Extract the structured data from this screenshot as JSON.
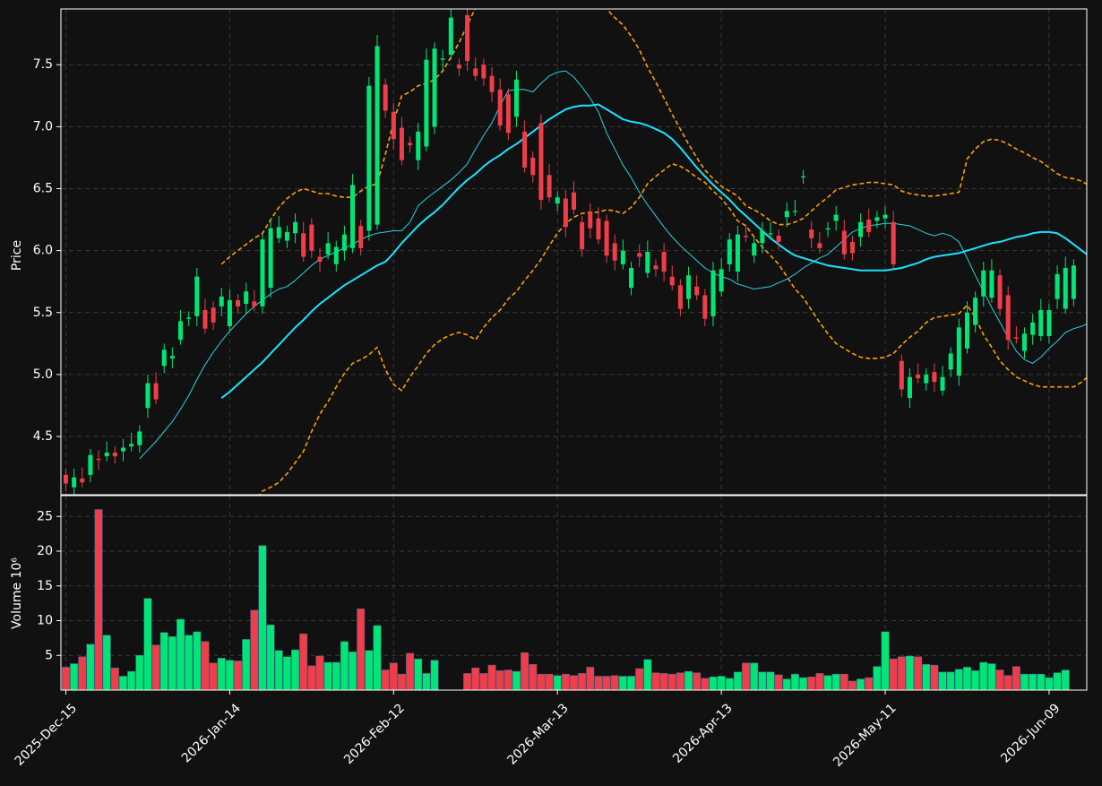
{
  "colors": {
    "background": "#111111",
    "up": "#00e676",
    "down": "#ef3e4a",
    "grid": "#3a3a3a",
    "axis": "#ffffff",
    "ma_short": "#26d4e4",
    "ma_long": "#19e3ff",
    "bands": "#ff9f00"
  },
  "chart_data": [
    {
      "type": "candlestick",
      "ylabel": "Price",
      "ylim": [
        4.03,
        7.95
      ],
      "yticks": [
        "4.5",
        "5.0",
        "5.5",
        "6.0",
        "6.5",
        "7.0",
        "7.5"
      ],
      "xlim": [
        -0.6,
        124.6
      ],
      "x_tick_labels": [
        "2025-Dec-15",
        "2026-Jan-14",
        "2026-Feb-12",
        "2026-Mar-13",
        "2026-Apr-13",
        "2026-May-11",
        "2026-Jun-09"
      ],
      "x_tick_positions": [
        0,
        20,
        40,
        60,
        80,
        100,
        120
      ],
      "grid": true,
      "open": [
        4.19,
        4.09,
        4.16,
        4.19,
        4.32,
        4.34,
        4.37,
        4.38,
        4.42,
        4.43,
        4.73,
        4.93,
        5.07,
        5.13,
        5.28,
        5.45,
        5.47,
        5.52,
        5.54,
        5.55,
        5.39,
        5.6,
        5.57,
        5.59,
        5.55,
        5.7,
        6.1,
        6.08,
        6.14,
        6.14,
        6.21,
        5.95,
        5.97,
        5.89,
        6.0,
        6.02,
        6.2,
        6.16,
        6.21,
        7.34,
        7.12,
        6.99,
        6.87,
        6.73,
        6.84,
        7.0,
        7.54,
        7.58,
        7.5,
        7.9,
        7.47,
        7.5,
        7.41,
        7.3,
        7.26,
        7.08,
        6.96,
        6.75,
        7.03,
        6.61,
        6.38,
        6.42,
        6.47,
        6.23,
        6.31,
        6.26,
        6.24,
        6.06,
        5.89,
        5.7,
        5.98,
        5.82,
        5.88,
        5.99,
        5.79,
        5.72,
        5.61,
        5.71,
        5.64,
        5.47,
        5.67,
        5.89,
        5.83,
        6.12,
        5.96,
        6.06,
        6.14,
        6.12,
        6.27,
        6.32,
        6.6,
        6.17,
        6.06,
        6.17,
        6.24,
        6.16,
        6.07,
        6.11,
        6.25,
        6.24,
        6.26,
        6.23,
        5.11,
        4.81,
        5.0,
        4.93,
        5.02,
        4.87,
        5.04,
        4.99,
        5.21,
        5.4,
        5.63,
        5.62,
        5.8,
        5.64,
        5.3,
        5.19,
        5.32,
        5.31,
        5.31,
        5.61,
        5.53,
        5.61
      ],
      "close": [
        4.12,
        4.17,
        4.13,
        4.35,
        4.31,
        4.37,
        4.34,
        4.41,
        4.44,
        4.54,
        4.93,
        4.8,
        5.2,
        5.15,
        5.43,
        5.46,
        5.79,
        5.37,
        5.42,
        5.63,
        5.6,
        5.55,
        5.67,
        5.55,
        6.09,
        6.18,
        6.19,
        6.15,
        6.23,
        5.95,
        6.0,
        5.91,
        6.06,
        6.03,
        6.13,
        6.53,
        6.02,
        7.33,
        7.65,
        7.13,
        6.9,
        6.73,
        6.85,
        6.96,
        7.54,
        7.63,
        7.55,
        7.88,
        7.47,
        7.53,
        7.41,
        7.39,
        7.28,
        7.01,
        6.95,
        7.38,
        6.67,
        6.61,
        6.41,
        6.43,
        6.43,
        6.19,
        6.33,
        6.01,
        6.18,
        6.09,
        5.96,
        5.92,
        6.0,
        5.86,
        5.95,
        5.99,
        5.85,
        5.83,
        5.72,
        5.53,
        5.8,
        5.64,
        5.45,
        5.84,
        5.85,
        6.09,
        6.13,
        6.11,
        6.06,
        6.16,
        6.14,
        6.07,
        6.32,
        6.32,
        6.6,
        6.1,
        6.02,
        6.18,
        6.29,
        5.97,
        5.98,
        6.23,
        6.15,
        6.27,
        6.29,
        5.89,
        4.88,
        4.98,
        4.97,
        5.0,
        4.94,
        4.98,
        5.17,
        5.38,
        5.5,
        5.62,
        5.84,
        5.84,
        5.53,
        5.28,
        5.29,
        5.33,
        5.42,
        5.52,
        5.52,
        5.81,
        5.86,
        5.88
      ],
      "volume_ylabel": "Volume  10⁶",
      "volume_ylim": [
        0,
        28
      ],
      "volume_yticks": [
        "5",
        "10",
        "15",
        "20",
        "25"
      ],
      "volume": [
        3.3,
        3.8,
        4.8,
        6.6,
        26.0,
        7.9,
        3.2,
        2.0,
        2.7,
        5.0,
        13.2,
        6.5,
        8.3,
        7.7,
        10.2,
        7.9,
        8.4,
        7.0,
        3.9,
        4.6,
        4.3,
        4.2,
        7.3,
        11.5,
        20.8,
        9.4,
        5.7,
        4.8,
        5.8,
        8.1,
        3.5,
        4.9,
        4.0,
        4.0,
        7.0,
        5.5,
        11.7,
        5.7,
        9.3,
        2.9,
        3.9,
        2.3,
        5.3,
        4.5,
        2.4,
        4.3,
        0,
        0,
        0,
        2.4,
        3.2,
        2.4,
        3.6,
        2.8,
        2.9,
        2.7,
        5.4,
        3.7,
        2.3,
        2.3,
        2.1,
        2.3,
        2.1,
        2.4,
        3.3,
        2.0,
        2.0,
        2.1,
        2.0,
        2.0,
        3.1,
        4.4,
        2.5,
        2.4,
        2.3,
        2.5,
        2.7,
        2.5,
        1.7,
        1.9,
        2.0,
        1.7,
        2.6,
        3.9,
        3.9,
        2.6,
        2.6,
        2.2,
        1.6,
        2.3,
        1.8,
        1.9,
        2.4,
        2.1,
        2.3,
        2.3,
        1.3,
        1.6,
        1.8,
        3.4,
        8.4,
        4.5,
        4.8,
        4.9,
        4.8,
        3.7,
        3.6,
        2.6,
        2.6,
        3.0,
        3.3,
        2.8,
        4.0,
        3.8,
        2.9,
        2.1,
        3.4,
        2.3,
        2.3,
        2.3,
        1.8,
        2.5,
        2.9
      ],
      "overlays": {
        "ma_short": {
          "start": 9,
          "values": [
            4.32,
            4.39,
            4.46,
            4.54,
            4.62,
            4.72,
            4.83,
            4.96,
            5.08,
            5.18,
            5.27,
            5.35,
            5.42,
            5.49,
            5.55,
            5.6,
            5.65,
            5.69,
            5.71,
            5.76,
            5.82,
            5.88,
            5.93,
            5.96,
            5.99,
            6.02,
            6.05,
            6.09,
            6.12,
            6.14,
            6.15,
            6.16,
            6.16,
            6.23,
            6.36,
            6.42,
            6.47,
            6.52,
            6.57,
            6.63,
            6.7,
            6.82,
            6.93,
            7.03,
            7.17,
            7.29,
            7.3,
            7.3,
            7.28,
            7.35,
            7.41,
            7.44,
            7.45,
            7.4,
            7.32,
            7.23,
            7.12,
            6.95,
            6.82,
            6.69,
            6.59,
            6.47,
            6.37,
            6.28,
            6.19,
            6.11,
            6.04,
            5.98,
            5.92,
            5.86,
            5.82,
            5.79,
            5.77,
            5.73,
            5.71,
            5.69,
            5.7,
            5.71,
            5.74,
            5.77,
            5.81,
            5.86,
            5.9,
            5.94,
            5.97,
            6.03,
            6.09,
            6.15,
            6.18,
            6.2,
            6.21,
            6.22,
            6.22,
            6.21,
            6.2,
            6.17,
            6.14,
            6.12,
            6.14,
            6.12,
            6.07,
            5.94,
            5.8,
            5.67,
            5.54,
            5.42,
            5.3,
            5.19,
            5.12,
            5.09,
            5.14,
            5.21,
            5.27,
            5.34,
            5.37,
            5.39,
            5.42,
            5.46,
            5.48,
            5.49,
            5.5,
            5.5,
            5.49,
            5.5,
            5.51
          ]
        },
        "ma_long": {
          "start": 19,
          "values": [
            4.81,
            4.86,
            4.92,
            4.98,
            5.04,
            5.1,
            5.17,
            5.24,
            5.31,
            5.38,
            5.44,
            5.51,
            5.57,
            5.62,
            5.67,
            5.72,
            5.76,
            5.8,
            5.84,
            5.88,
            5.91,
            5.98,
            6.06,
            6.13,
            6.2,
            6.26,
            6.31,
            6.37,
            6.44,
            6.51,
            6.57,
            6.62,
            6.68,
            6.73,
            6.77,
            6.82,
            6.86,
            6.91,
            6.96,
            7.01,
            7.06,
            7.1,
            7.14,
            7.16,
            7.17,
            7.17,
            7.18,
            7.14,
            7.1,
            7.06,
            7.04,
            7.03,
            7.01,
            6.98,
            6.95,
            6.9,
            6.83,
            6.75,
            6.67,
            6.6,
            6.53,
            6.47,
            6.41,
            6.34,
            6.28,
            6.22,
            6.16,
            6.1,
            6.05,
            6.0,
            5.96,
            5.94,
            5.92,
            5.9,
            5.88,
            5.87,
            5.86,
            5.85,
            5.84,
            5.84,
            5.84,
            5.84,
            5.85,
            5.86,
            5.88,
            5.9,
            5.93,
            5.95,
            5.96,
            5.97,
            5.98,
            6.0,
            6.02,
            6.04,
            6.06,
            6.07,
            6.09,
            6.11,
            6.12,
            6.14,
            6.15,
            6.15,
            6.14,
            6.1,
            6.05,
            6.0,
            5.95,
            5.89,
            5.82,
            5.76,
            5.71,
            5.67,
            5.64,
            5.61,
            5.59,
            5.56,
            5.53,
            5.49,
            5.45,
            5.41,
            5.37,
            5.34,
            5.32,
            5.31,
            5.34,
            5.38,
            5.42
          ]
        },
        "upper_band": {
          "start": 19,
          "values": [
            5.89,
            5.95,
            6.0,
            6.05,
            6.1,
            6.14,
            6.25,
            6.35,
            6.42,
            6.47,
            6.5,
            6.48,
            6.46,
            6.46,
            6.44,
            6.43,
            6.43,
            6.48,
            6.52,
            6.54,
            6.78,
            7.04,
            7.25,
            7.28,
            7.33,
            7.35,
            7.38,
            7.45,
            7.56,
            7.68,
            7.82,
            7.96,
            7.98,
            8.0,
            8.02,
            8.03,
            8.05,
            8.06,
            8.08,
            8.09,
            8.08,
            8.06,
            8.06,
            8.05,
            8.04,
            8.03,
            8.02,
            7.95,
            7.88,
            7.82,
            7.73,
            7.62,
            7.48,
            7.36,
            7.23,
            7.1,
            6.98,
            6.86,
            6.75,
            6.65,
            6.58,
            6.52,
            6.48,
            6.44,
            6.36,
            6.33,
            6.29,
            6.24,
            6.21,
            6.21,
            6.23,
            6.26,
            6.32,
            6.38,
            6.43,
            6.49,
            6.51,
            6.53,
            6.54,
            6.55,
            6.55,
            6.54,
            6.53,
            6.48,
            6.46,
            6.45,
            6.44,
            6.44,
            6.45,
            6.46,
            6.47,
            6.74,
            6.82,
            6.88,
            6.9,
            6.89,
            6.86,
            6.82,
            6.79,
            6.75,
            6.72,
            6.67,
            6.62,
            6.59,
            6.58,
            6.56,
            6.52,
            6.47,
            6.43,
            6.39,
            6.33,
            6.26,
            6.18,
            6.09,
            5.94,
            5.88,
            5.87,
            5.89,
            5.93,
            5.96,
            6.0
          ]
        },
        "lower_band": {
          "start": 19,
          "values": [
            3.73,
            3.77,
            3.84,
            3.91,
            3.98,
            4.06,
            4.09,
            4.13,
            4.2,
            4.29,
            4.38,
            4.54,
            4.68,
            4.78,
            4.9,
            5.01,
            5.09,
            5.12,
            5.16,
            5.22,
            5.04,
            4.92,
            4.87,
            4.98,
            5.07,
            5.17,
            5.24,
            5.29,
            5.32,
            5.34,
            5.32,
            5.28,
            5.38,
            5.46,
            5.52,
            5.61,
            5.67,
            5.76,
            5.84,
            5.93,
            6.04,
            6.14,
            6.22,
            6.27,
            6.3,
            6.31,
            6.31,
            6.33,
            6.32,
            6.3,
            6.35,
            6.43,
            6.54,
            6.6,
            6.65,
            6.7,
            6.68,
            6.64,
            6.59,
            6.55,
            6.48,
            6.42,
            6.34,
            6.24,
            6.2,
            6.11,
            6.03,
            5.96,
            5.89,
            5.79,
            5.69,
            5.62,
            5.52,
            5.42,
            5.33,
            5.25,
            5.21,
            5.17,
            5.14,
            5.13,
            5.13,
            5.14,
            5.17,
            5.24,
            5.3,
            5.35,
            5.42,
            5.46,
            5.47,
            5.48,
            5.49,
            5.56,
            5.46,
            5.32,
            5.22,
            5.11,
            5.04,
            4.98,
            4.95,
            4.92,
            4.9,
            4.9,
            4.9,
            4.9,
            4.9,
            4.94,
            5.0,
            5.03,
            5.03,
            5.05,
            5.09,
            5.15,
            5.21,
            5.32,
            5.47,
            5.54,
            5.61,
            5.68,
            5.74,
            5.79,
            5.84
          ]
        }
      }
    }
  ]
}
